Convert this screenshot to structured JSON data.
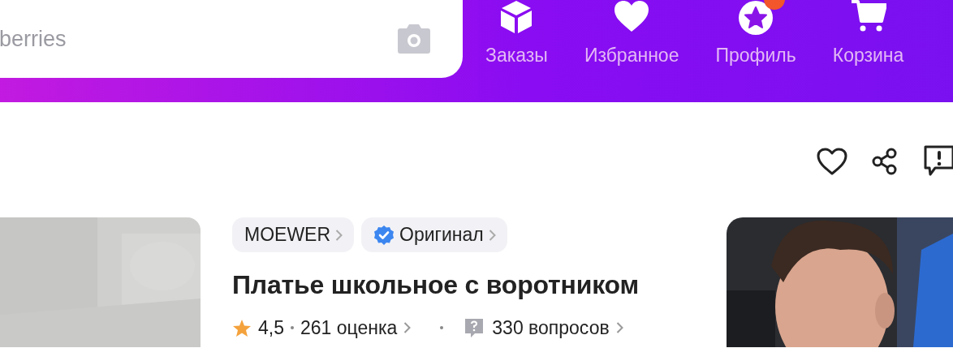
{
  "header": {
    "search": {
      "placeholder": "berries"
    },
    "nav": [
      {
        "kind": "orders",
        "label": "Заказы"
      },
      {
        "kind": "favorites",
        "label": "Избранное"
      },
      {
        "kind": "profile",
        "label": "Профиль",
        "badge": true
      },
      {
        "kind": "cart",
        "label": "Корзина"
      }
    ]
  },
  "actions": [
    {
      "kind": "favorite"
    },
    {
      "kind": "share"
    },
    {
      "kind": "report"
    }
  ],
  "product": {
    "chips": [
      {
        "label": "MOEWER",
        "verified": false
      },
      {
        "label": "Оригинал",
        "verified": true
      }
    ],
    "title": "Платье школьное с воротником",
    "rating": "4,5",
    "reviews": "261 оценка",
    "questions": "330 вопросов"
  }
}
